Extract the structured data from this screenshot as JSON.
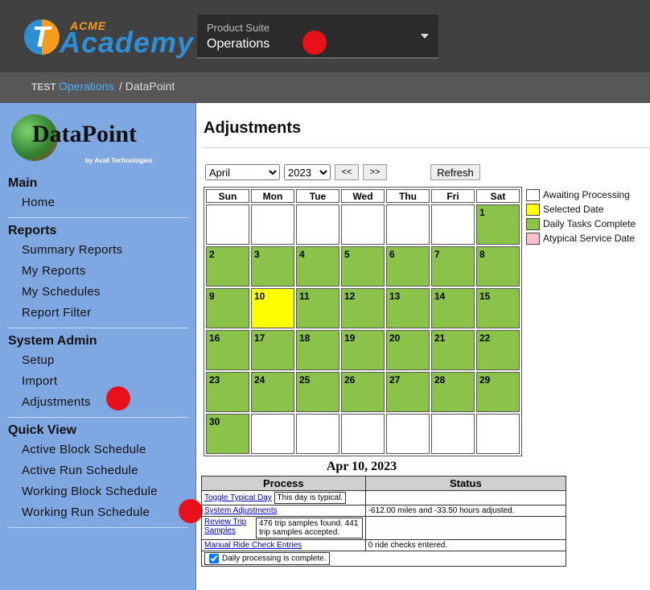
{
  "header": {
    "logo_top": "ACME",
    "logo_main": "Academy",
    "logo_badge": "T",
    "product_suite_label": "Product Suite",
    "product_suite_value": "Operations"
  },
  "breadcrumb": {
    "env": "TEST",
    "link": "Operations",
    "rest": "/ DataPoint"
  },
  "sidebar": {
    "logo_word": "DataPoint",
    "logo_by": "by Avail Technologies",
    "sections": [
      {
        "title": "Main",
        "items": [
          "Home"
        ]
      },
      {
        "title": "Reports",
        "items": [
          "Summary Reports",
          "My Reports",
          "My Schedules",
          "Report Filter"
        ]
      },
      {
        "title": "System Admin",
        "items": [
          "Setup",
          "Import",
          "Adjustments"
        ]
      },
      {
        "title": "Quick View",
        "items": [
          "Active Block Schedule",
          "Active Run Schedule",
          "Working Block Schedule",
          "Working Run Schedule"
        ]
      }
    ]
  },
  "main": {
    "title": "Adjustments",
    "month": "April",
    "year": "2023",
    "prev": "<<",
    "next": ">>",
    "refresh": "Refresh",
    "weekdays": [
      "Sun",
      "Mon",
      "Tue",
      "Wed",
      "Thu",
      "Fri",
      "Sat"
    ],
    "calendar_rows": [
      [
        [
          "",
          ""
        ],
        [
          "",
          ""
        ],
        [
          "",
          ""
        ],
        [
          "",
          ""
        ],
        [
          "",
          ""
        ],
        [
          "",
          ""
        ],
        [
          "1",
          "g"
        ]
      ],
      [
        [
          "2",
          "g"
        ],
        [
          "3",
          "g"
        ],
        [
          "4",
          "g"
        ],
        [
          "5",
          "g"
        ],
        [
          "6",
          "g"
        ],
        [
          "7",
          "g"
        ],
        [
          "8",
          "g"
        ]
      ],
      [
        [
          "9",
          "g"
        ],
        [
          "10",
          "y"
        ],
        [
          "11",
          "g"
        ],
        [
          "12",
          "g"
        ],
        [
          "13",
          "g"
        ],
        [
          "14",
          "g"
        ],
        [
          "15",
          "g"
        ]
      ],
      [
        [
          "16",
          "g"
        ],
        [
          "17",
          "g"
        ],
        [
          "18",
          "g"
        ],
        [
          "19",
          "g"
        ],
        [
          "20",
          "g"
        ],
        [
          "21",
          "g"
        ],
        [
          "22",
          "g"
        ]
      ],
      [
        [
          "23",
          "g"
        ],
        [
          "24",
          "g"
        ],
        [
          "25",
          "g"
        ],
        [
          "26",
          "g"
        ],
        [
          "27",
          "g"
        ],
        [
          "28",
          "g"
        ],
        [
          "29",
          "g"
        ]
      ],
      [
        [
          "30",
          "g"
        ],
        [
          "",
          ""
        ],
        [
          "",
          ""
        ],
        [
          "",
          ""
        ],
        [
          "",
          ""
        ],
        [
          "",
          ""
        ],
        [
          "",
          ""
        ]
      ]
    ],
    "legend": [
      {
        "label": "Awaiting Processing",
        "color": "#ffffff"
      },
      {
        "label": "Selected Date",
        "color": "#ffff00"
      },
      {
        "label": "Daily Tasks Complete",
        "color": "#8bc34a"
      },
      {
        "label": "Atypical Service Date",
        "color": "#ffc0cb"
      }
    ],
    "day_title": "Apr 10, 2023",
    "process_header": "Process",
    "status_header": "Status",
    "toggle_link": "Toggle Typical Day",
    "toggle_note": "This day is typical.",
    "sysadj_link": "System Adjustments",
    "sysadj_status": "-612.00 miles and -33.50 hours adjusted.",
    "review_link": "Review Trip Samples",
    "review_note": "476 trip samples found. 441 trip samples accepted.",
    "manual_link": "Manual Ride Check Entries",
    "manual_status": "0 ride checks entered.",
    "daily_complete": "Daily processing is complete."
  }
}
